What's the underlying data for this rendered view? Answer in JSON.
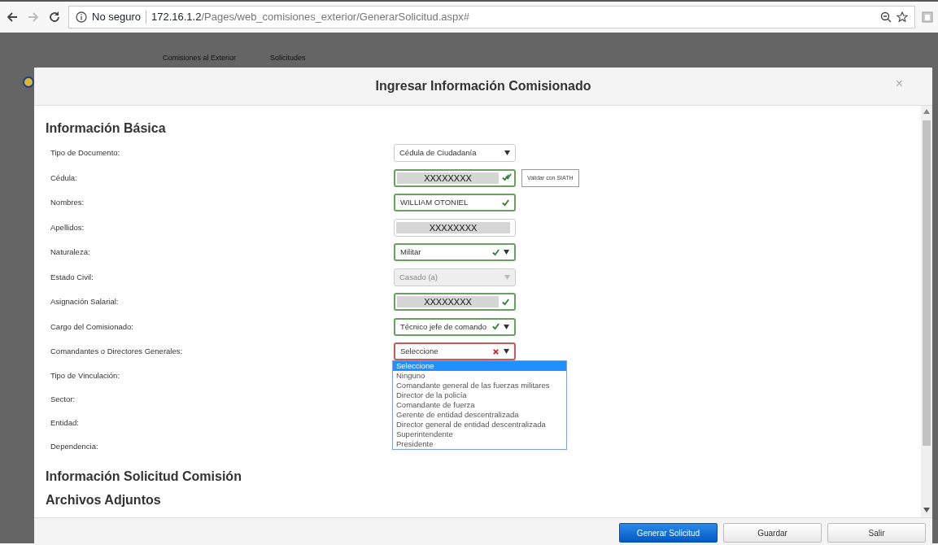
{
  "browser": {
    "security": "No seguro",
    "url_host": "172.16.1.2",
    "url_path": "/Pages/web_comisiones_exterior/GenerarSolicitud.aspx#",
    "forward_disabled": true
  },
  "background_nav": [
    "Comisiones al Exterior",
    "Solicitudes"
  ],
  "modal": {
    "title": "Ingresar Información Comisionado",
    "close": "×",
    "sections": [
      {
        "heading": "Información Básica",
        "rows": [
          {
            "label": "Tipo de Documento:",
            "kind": "select",
            "value": "Cédula de Ciudadanía",
            "valid": false,
            "error": false,
            "masked": false,
            "disabled": false
          },
          {
            "label": "Cédula:",
            "kind": "text",
            "value": "XXXXXXXX",
            "valid": true,
            "error": false,
            "masked": true,
            "disabled": false,
            "action": "Validar con SIATH"
          },
          {
            "label": "Nombres:",
            "kind": "text",
            "value": "WILLIAM OTONIEL",
            "valid": true,
            "error": false,
            "masked": false,
            "disabled": false
          },
          {
            "label": "Apellidos:",
            "kind": "text",
            "value": "XXXXXXXX",
            "valid": false,
            "error": false,
            "masked": true,
            "disabled": false
          },
          {
            "label": "Naturaleza:",
            "kind": "select",
            "value": "Militar",
            "valid": true,
            "error": false,
            "masked": false,
            "disabled": false
          },
          {
            "label": "Estado Civil:",
            "kind": "select",
            "value": "Casado (a)",
            "valid": false,
            "error": false,
            "masked": false,
            "disabled": true
          },
          {
            "label": "Asignación Salarial:",
            "kind": "text",
            "value": "XXXXXXXX",
            "valid": true,
            "error": false,
            "masked": true,
            "disabled": false
          },
          {
            "label": "Cargo del Comisionado:",
            "kind": "select",
            "value": "Técnico jefe de comando",
            "valid": true,
            "error": false,
            "masked": false,
            "disabled": false
          },
          {
            "label": "Comandantes o Directores Generales:",
            "kind": "select",
            "value": "Seleccione",
            "valid": false,
            "error": true,
            "masked": false,
            "disabled": false,
            "expanded": true,
            "options": [
              {
                "label": "Seleccione",
                "selected": true
              },
              {
                "label": "Ninguno",
                "selected": false
              },
              {
                "label": "Comandante general de las fuerzas militares",
                "selected": false
              },
              {
                "label": "Director de la policía",
                "selected": false
              },
              {
                "label": "Comandante de fuerza",
                "selected": false
              },
              {
                "label": "Gerente de entidad descentralizada",
                "selected": false
              },
              {
                "label": "Director general de entidad descentralizada",
                "selected": false
              },
              {
                "label": "Superintendente",
                "selected": false
              },
              {
                "label": "Presidente",
                "selected": false
              }
            ]
          },
          {
            "label": "Tipo de Vinculación:",
            "kind": "label"
          },
          {
            "label": "Sector:",
            "kind": "label"
          },
          {
            "label": "Entidad:",
            "kind": "label"
          },
          {
            "label": "Dependencia:",
            "kind": "label"
          }
        ]
      },
      {
        "heading": "Información Solicitud Comisión"
      },
      {
        "heading": "Archivos Adjuntos"
      }
    ],
    "buttons": [
      {
        "label": "Generar Solicitud",
        "kind": "primary"
      },
      {
        "label": "Guardar",
        "kind": "default"
      },
      {
        "label": "Salir",
        "kind": "default"
      }
    ]
  }
}
